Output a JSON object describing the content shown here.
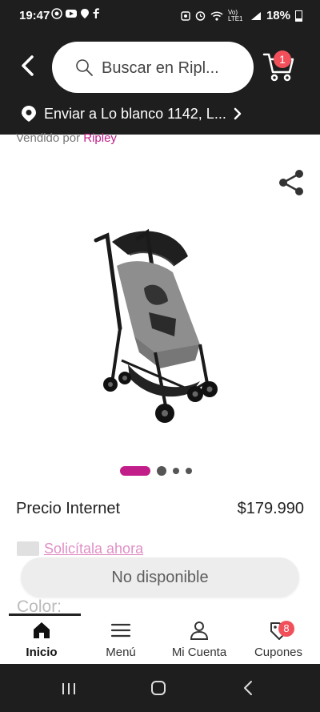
{
  "status_bar": {
    "time": "19:47",
    "left_icons": [
      "whatsapp-icon",
      "youtube-icon",
      "location-icon",
      "facebook-icon"
    ],
    "network_text": "Vo) LTE1",
    "battery": "18%"
  },
  "header": {
    "search": {
      "placeholder": "Buscar en Ripl..."
    },
    "cart_count": "1",
    "location": {
      "text": "Enviar a Lo blanco  1142, L..."
    }
  },
  "product": {
    "sold_by_prefix": "Vendido por ",
    "sold_by_seller": "Ripley",
    "price_label": "Precio Internet",
    "price_value": "$179.990",
    "credit_link": "Solicítala ahora",
    "availability": "No disponible",
    "color_label": "Color:",
    "carousel": {
      "count": 4,
      "active_index": 0
    }
  },
  "bottom_nav": {
    "items": [
      {
        "label": "Inicio",
        "icon": "home-icon",
        "active": true
      },
      {
        "label": "Menú",
        "icon": "menu-icon",
        "active": false
      },
      {
        "label": "Mi Cuenta",
        "icon": "user-icon",
        "active": false
      },
      {
        "label": "Cupones",
        "icon": "coupon-icon",
        "active": false
      }
    ],
    "coupon_count": "8"
  },
  "colors": {
    "brand_magenta": "#c21e8a",
    "header_bg": "#1e1e1e",
    "badge_red": "#f1505a"
  }
}
